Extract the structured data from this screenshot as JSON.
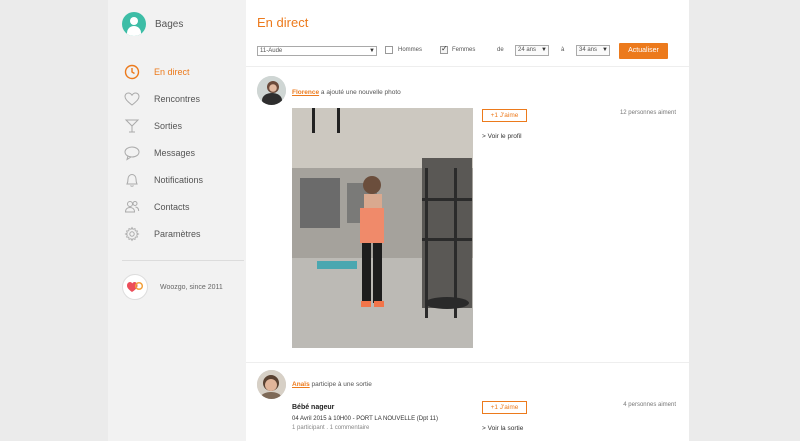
{
  "user": {
    "name": "Bages"
  },
  "nav": [
    {
      "label": "En direct",
      "icon": "clock-icon"
    },
    {
      "label": "Rencontres",
      "icon": "heart-icon"
    },
    {
      "label": "Sorties",
      "icon": "cocktail-icon"
    },
    {
      "label": "Messages",
      "icon": "speech-bubble-icon"
    },
    {
      "label": "Notifications",
      "icon": "bell-icon"
    },
    {
      "label": "Contacts",
      "icon": "users-icon"
    },
    {
      "label": "Paramètres",
      "icon": "gear-icon"
    }
  ],
  "brand": {
    "text": "Woozgo, since 2011"
  },
  "page": {
    "title": "En direct"
  },
  "filters": {
    "region": "11-Aude",
    "hommes_label": "Hommes",
    "femmes_label": "Femmes",
    "de_label": "de",
    "a_label": "à",
    "age_from": "24 ans",
    "age_to": "34 ans",
    "update_label": "Actualiser"
  },
  "posts": [
    {
      "name": "Florence",
      "action": " a ajouté une nouvelle photo",
      "like_label": "+1 J'aime",
      "likes": "12 personnes aiment",
      "link": "> Voir le profil"
    },
    {
      "name": "Anaïs",
      "action": " participe à une sortie",
      "event_title": "Bébé nageur",
      "event_date": "04 Avril 2015 à 10H00 - PORT LA NOUVELLE (Dpt 11)",
      "event_meta": "1 participant . 1 commentaire",
      "like_label": "+1 J'aime",
      "likes": "4 personnes aiment",
      "link": "> Voir la sortie"
    }
  ],
  "colors": {
    "accent": "#ec7a1c",
    "avatar": "#3dbda6"
  }
}
